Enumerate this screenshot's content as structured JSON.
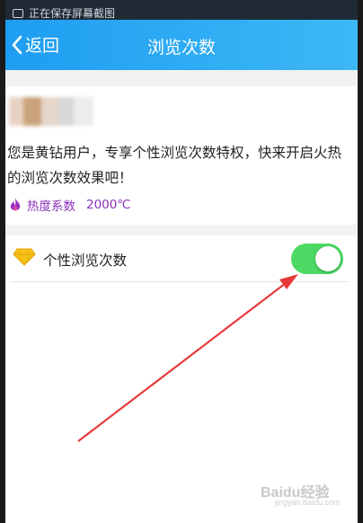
{
  "status_bar": {
    "saving_text": "正在保存屏幕截图"
  },
  "nav": {
    "back_label": "返回",
    "title": "浏览次数"
  },
  "card": {
    "description": "您是黄钻用户，专享个性浏览次数特权，快来开启火热的浏览次数效果吧！",
    "heat_label": "热度系数",
    "heat_value": "2000℃"
  },
  "setting": {
    "label": "个性浏览次数",
    "toggle_on": true
  },
  "watermark": {
    "text": "Baidu经验",
    "sub": "jingyan.baidu.com"
  },
  "colors": {
    "nav_start": "#1e9df2",
    "nav_end": "#3db8f5",
    "toggle_on": "#4cd964",
    "heat_text": "#8a2fb8",
    "arrow": "#e83a3a"
  }
}
